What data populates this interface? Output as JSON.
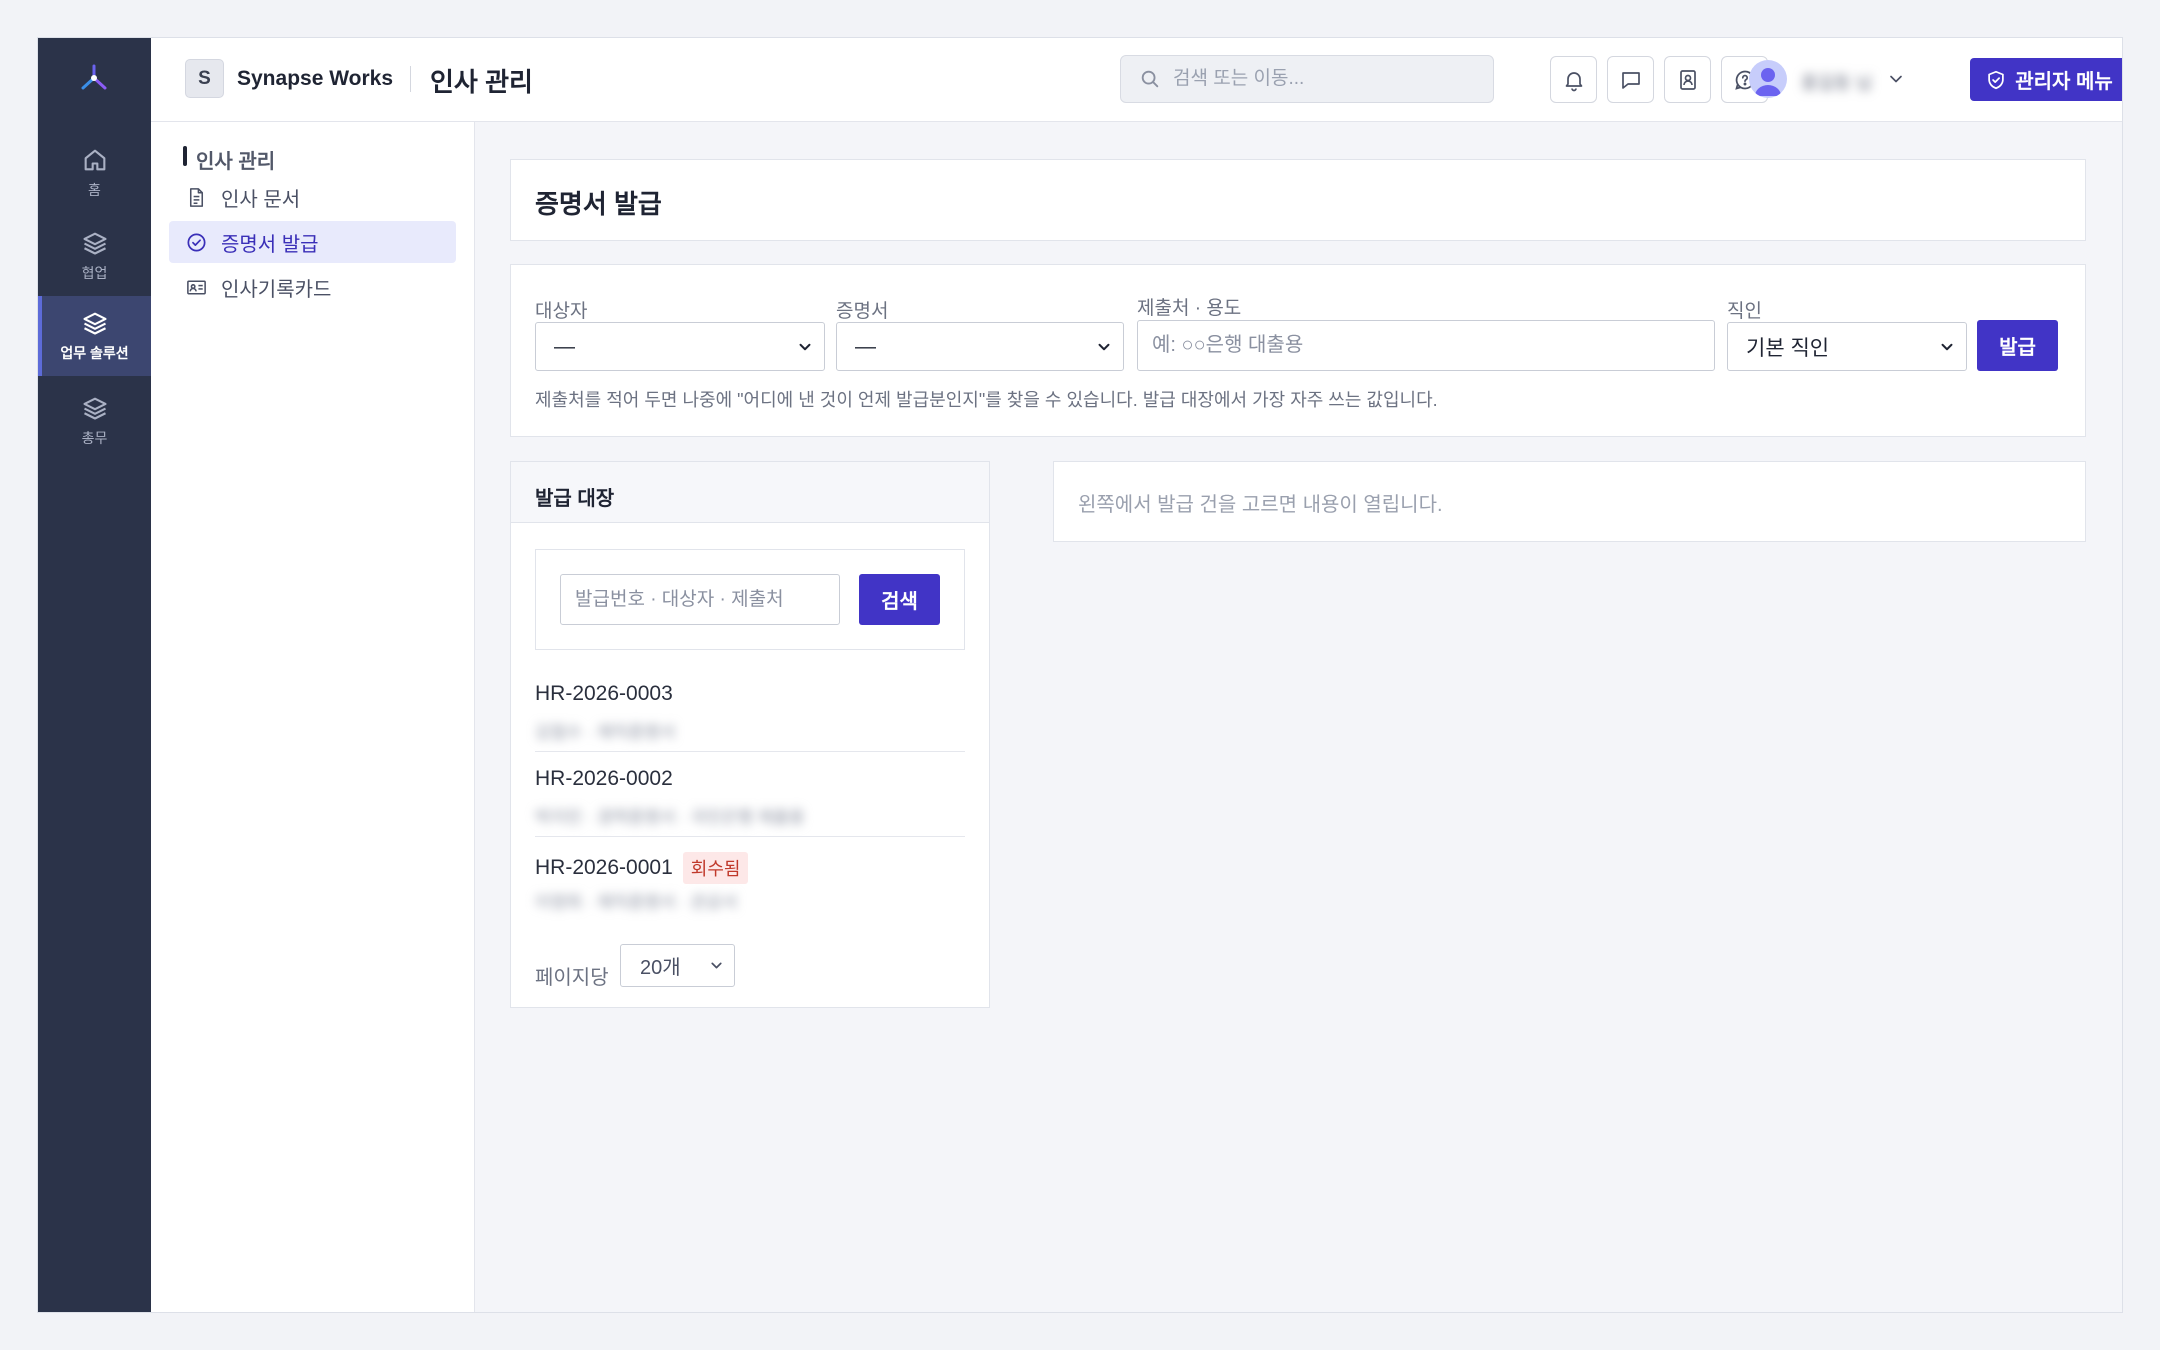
{
  "header": {
    "org_badge": "S",
    "org_name": "Synapse Works",
    "app_title": "인사 관리",
    "search_placeholder": "검색 또는 이동...",
    "user_name": "홍길동 님",
    "admin_button": "관리자 메뉴"
  },
  "rail": {
    "items": [
      {
        "label": "홈",
        "icon": "home-icon"
      },
      {
        "label": "협업",
        "icon": "layers-icon"
      },
      {
        "label": "업무 솔루션",
        "icon": "layers-icon",
        "active": true
      },
      {
        "label": "총무",
        "icon": "layers-icon"
      }
    ]
  },
  "subnav": {
    "title": "인사 관리",
    "items": [
      {
        "label": "인사 문서",
        "icon": "document-icon"
      },
      {
        "label": "증명서 발급",
        "icon": "check-circle-icon",
        "active": true
      },
      {
        "label": "인사기록카드",
        "icon": "id-card-icon"
      }
    ]
  },
  "page": {
    "title": "증명서 발급"
  },
  "form": {
    "target_label": "대상자",
    "target_value": "—",
    "cert_label": "증명서",
    "cert_value": "—",
    "purpose_label": "제출처 · 용도",
    "purpose_placeholder": "예: ○○은행 대출용",
    "seal_label": "직인",
    "seal_value": "기본 직인",
    "issue_button": "발급",
    "help_text": "제출처를 적어 두면 나중에 \"어디에 낸 것이 언제 발급분인지\"를 찾을 수 있습니다. 발급 대장에서 가장 자주 쓰는 값입니다."
  },
  "ledger": {
    "title": "발급 대장",
    "search_placeholder": "발급번호 · 대상자 · 제출처",
    "search_button": "검색",
    "rows": [
      {
        "number": "HR-2026-0003",
        "sub": "김철수 · 재직증명서",
        "badge": ""
      },
      {
        "number": "HR-2026-0002",
        "sub": "박지민 · 경력증명서 · 국민은행 제출용",
        "badge": ""
      },
      {
        "number": "HR-2026-0001",
        "sub": "이영희 · 재직증명서 · 관공서",
        "badge": "회수됨"
      }
    ],
    "per_page_label": "페이지당",
    "per_page_value": "20개"
  },
  "detail": {
    "empty_text": "왼쪽에서 발급 건을 고르면 내용이 열립니다."
  },
  "colors": {
    "accent": "#4134c6",
    "rail_bg": "#2b3349",
    "danger": "#c0392b"
  }
}
